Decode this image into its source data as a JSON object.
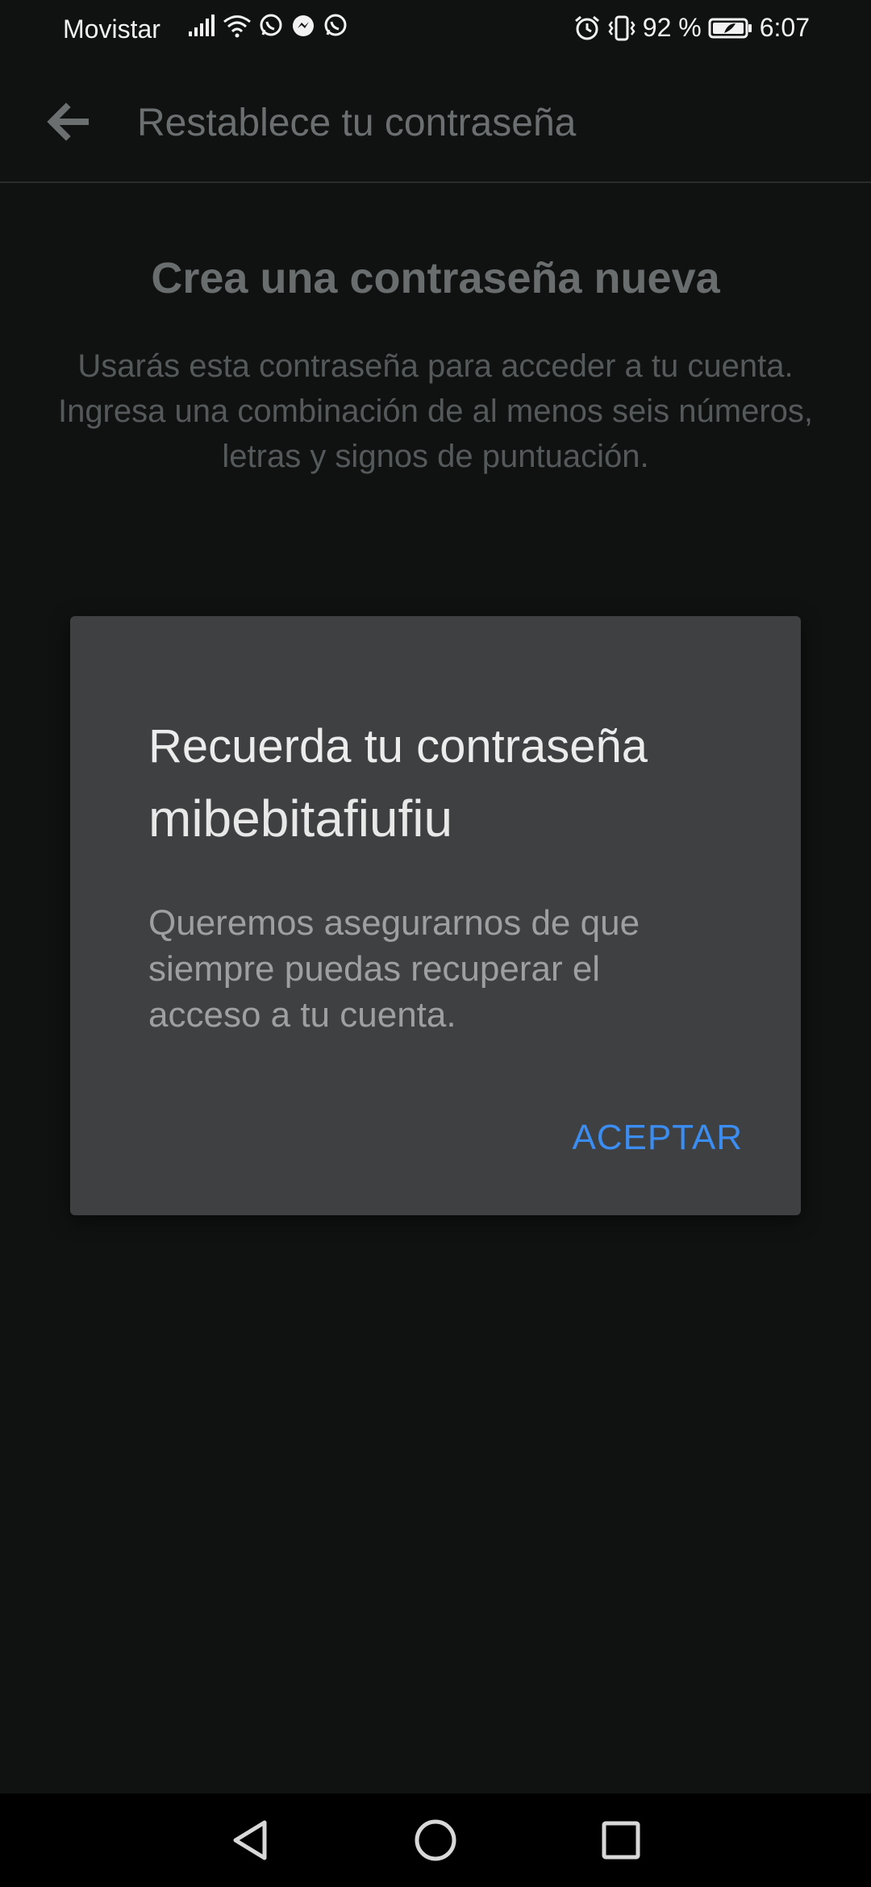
{
  "status_bar": {
    "carrier": "Movistar",
    "battery_percent": "92 %",
    "time": "6:07",
    "left_icons": [
      "signal-icon",
      "wifi-icon",
      "whatsapp-icon",
      "messenger-icon",
      "whatsapp-icon"
    ],
    "right_icons": [
      "alarm-icon",
      "vibrate-icon",
      "battery-icon"
    ]
  },
  "app_bar": {
    "back_icon": "arrow-left-icon",
    "title": "Restablece tu contraseña"
  },
  "page": {
    "heading": "Crea una contraseña nueva",
    "instructions": "Usarás esta contraseña para acceder a tu cuenta. Ingresa una combinación de al menos seis números, letras y signos de puntuación."
  },
  "dialog": {
    "title": "Recuerda tu contraseña",
    "password": "mibebitafiufiu",
    "body": "Queremos asegurarnos de que siempre puedas recuperar el acceso a tu cuenta.",
    "accept_label": "ACEPTAR"
  },
  "nav_bar": {
    "icons": [
      "triangle-back-icon",
      "circle-home-icon",
      "square-recents-icon"
    ]
  },
  "colors": {
    "background": "#101212",
    "dialog_background": "#3f4042",
    "accent": "#3b8df2"
  }
}
